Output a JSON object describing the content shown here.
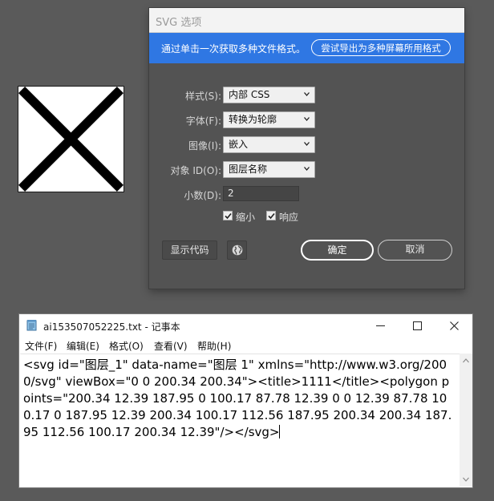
{
  "dialog": {
    "title": "SVG 选项",
    "banner_text": "通过单击一次获取多种文件格式。",
    "banner_button": "尝试导出为多种屏幕所用格式",
    "rows": [
      {
        "label": "样式(S):",
        "value": "内部 CSS"
      },
      {
        "label": "字体(F):",
        "value": "转换为轮廓"
      },
      {
        "label": "图像(I):",
        "value": "嵌入"
      },
      {
        "label": "对象 ID(O):",
        "value": "图层名称"
      }
    ],
    "decimal_label": "小数(D):",
    "decimal_value": "2",
    "checkbox_minify": "缩小",
    "checkbox_responsive": "响应",
    "show_code": "显示代码",
    "ok": "确定",
    "cancel": "取消"
  },
  "notepad": {
    "title": "ai153507052225.txt - 记事本",
    "menu": [
      "文件(F)",
      "编辑(E)",
      "格式(O)",
      "查看(V)",
      "帮助(H)"
    ],
    "content": "<svg id=\"图层_1\" data-name=\"图层 1\" xmlns=\"http://www.w3.org/2000/svg\" viewBox=\"0 0 200.34 200.34\"><title>1111</title><polygon points=\"200.34 12.39 187.95 0 100.17 87.78 12.39 0 0 12.39 87.78 100.17 0 187.95 12.39 200.34 100.17 112.56 187.95 200.34 200.34 187.95 112.56 100.17 200.34 12.39\"/></svg>"
  },
  "colors": {
    "dialog_bg": "#535353",
    "banner_bg": "#2f77e3",
    "desktop_bg": "#5a5a5a"
  },
  "icons": [
    "x-shape-preview",
    "chevron-down-icon",
    "checkmark-icon",
    "globe-icon",
    "notepad-icon",
    "minimize-icon",
    "maximize-icon",
    "close-icon",
    "scroll-up-icon",
    "scroll-down-icon"
  ]
}
